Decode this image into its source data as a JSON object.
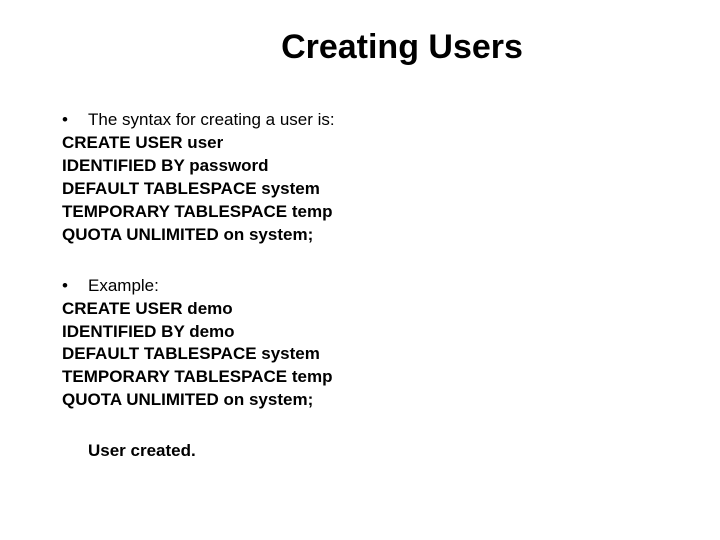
{
  "title": "Creating Users",
  "block1": {
    "bullet": "The syntax for creating a user is:",
    "lines": [
      "CREATE USER user",
      "IDENTIFIED BY   password",
      "DEFAULT TABLESPACE system",
      "TEMPORARY    TABLESPACE temp",
      "QUOTA UNLIMITED on system;"
    ]
  },
  "block2": {
    "bullet": "Example:",
    "lines": [
      "CREATE USER demo",
      "IDENTIFIED BY   demo",
      "DEFAULT TABLESPACE system",
      "TEMPORARY    TABLESPACE temp",
      "QUOTA UNLIMITED on system;"
    ]
  },
  "result": "User created."
}
